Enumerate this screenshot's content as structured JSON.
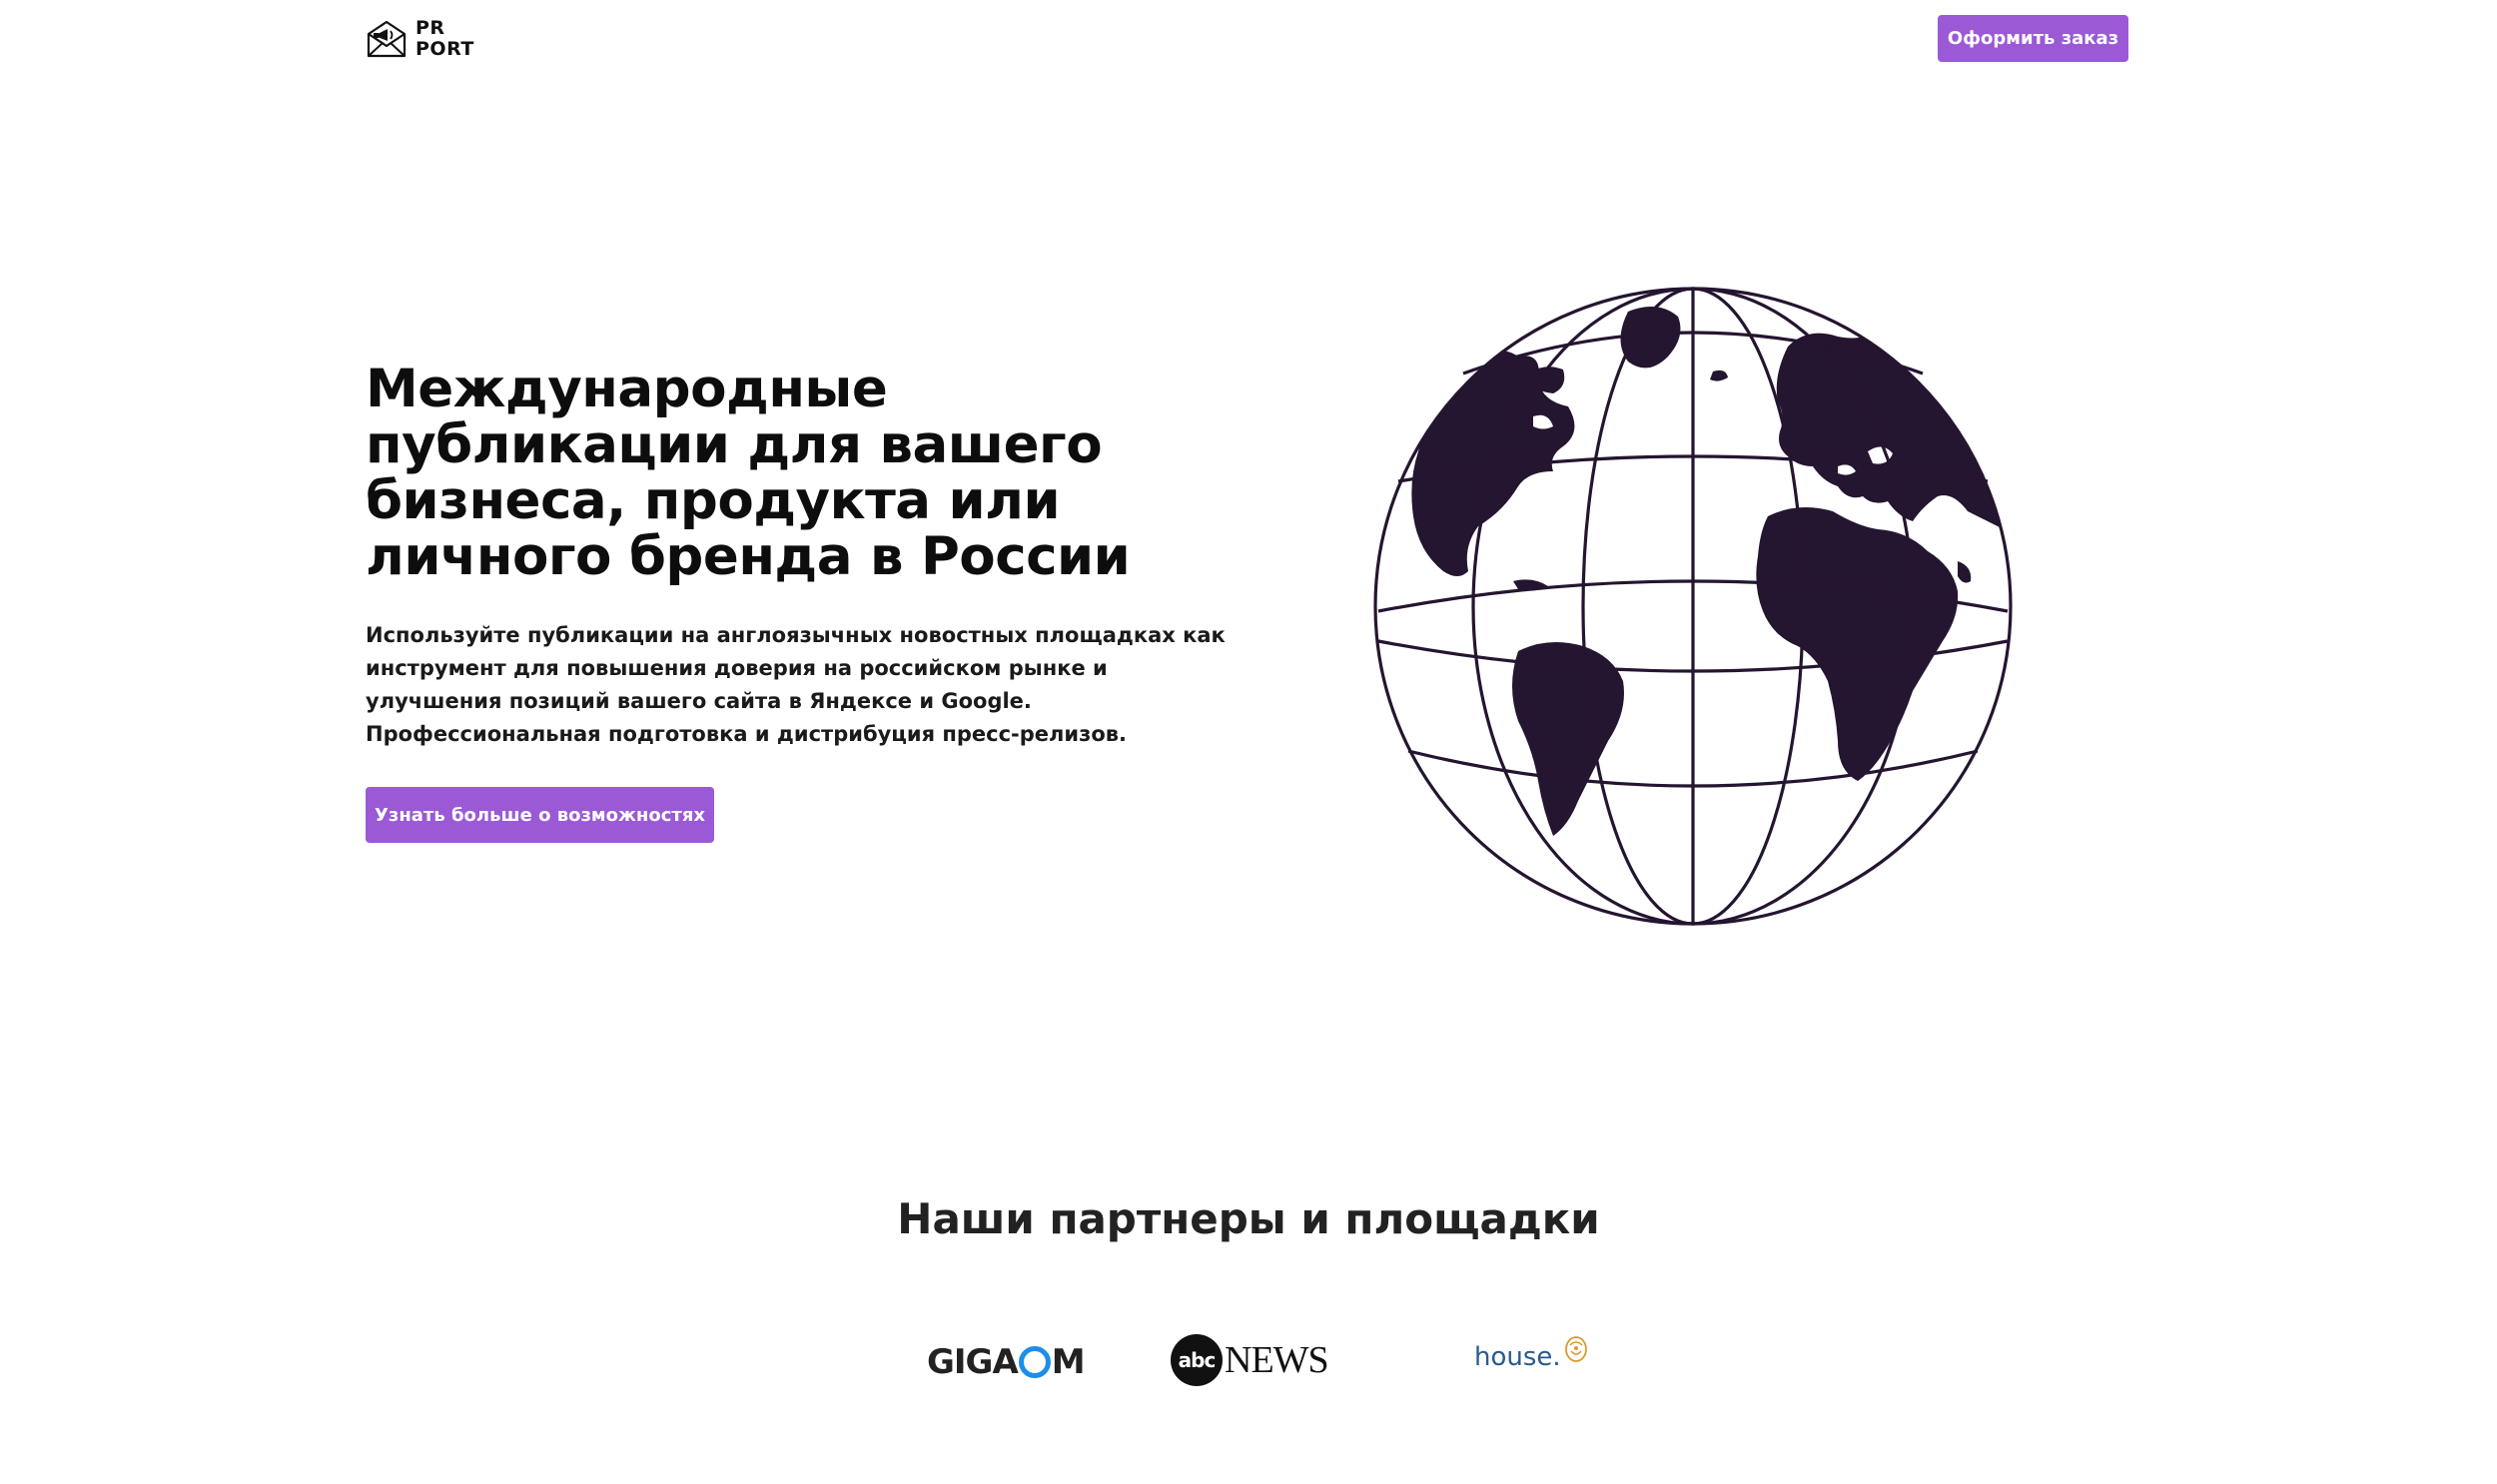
{
  "header": {
    "logo_line1": "PR",
    "logo_line2": "PORT",
    "order_button": "Оформить заказ"
  },
  "hero": {
    "title": "Международные публикации для вашего бизнеса, продукта или личного бренда в России",
    "description": "Используйте публикации на англоязычных новостных площадках как инструмент для повышения доверия на российском рынке и улучшения позиций вашего сайта в Яндексе и Google. Профессиональная подготовка и дистрибуция пресс-релизов.",
    "more_button": "Узнать больше о возможностях"
  },
  "partners": {
    "title": "Наши партнеры и площадки",
    "items": [
      {
        "name_prefix": "GIGA",
        "name_suffix": "M"
      },
      {
        "badge": "abc",
        "name": "NEWS"
      },
      {
        "name": "house."
      }
    ]
  },
  "colors": {
    "accent": "#9b59d6",
    "globe": "#241530",
    "gigaom_o": "#1e8ee6",
    "house_text": "#2a5b8c"
  },
  "icons": {
    "logo": "envelope-megaphone-icon",
    "hero_image": "globe-icon"
  }
}
